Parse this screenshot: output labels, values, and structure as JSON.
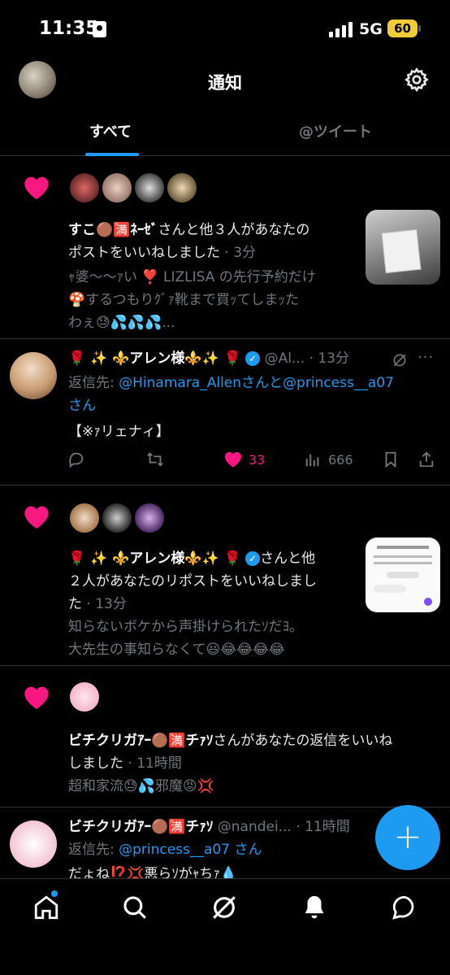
{
  "status": {
    "time": "11:35",
    "network": "5G",
    "battery": "60"
  },
  "header": {
    "title": "通知",
    "avatar_icon": "profile-avatar",
    "settings_icon": "gear-icon"
  },
  "tabs": [
    {
      "label": "すべて",
      "active": true
    },
    {
      "label": "@ツイート",
      "active": false
    }
  ],
  "notifications": [
    {
      "type": "like",
      "line1_name": "すこ🟤🈵ﾈｰｾﾞ",
      "line1_rest": "さんと他３人があなたの",
      "line2": "ポストをいいねしました",
      "time": "· 3分",
      "preview1": "ｬ婆〜〜ｧい ❣️ LIZLISA の先行予約だけ",
      "preview2": "🍄するつもりｸﾞｧ靴まで買ｯてしまｯた",
      "preview3": "わぇ😓💦💦💦..."
    },
    {
      "type": "reply",
      "name": "🌹 ✨ ⚜️アレン様⚜️✨ 🌹",
      "handle": "@Al...",
      "time": "· 13分",
      "reply_prefix": "返信先: ",
      "reply_user1": "@Hinamara_Allen",
      "reply_mid": "さんと",
      "reply_user2": "@princess__a07",
      "reply_suffix": "さん",
      "body": "【※ｧリェナィ】",
      "likes": "33",
      "views": "666"
    },
    {
      "type": "like",
      "line1_name": "🌹 ✨ ⚜️アレン様⚜️✨ 🌹",
      "line1_rest": "さんと他",
      "line2": "２人があなたのリポストをいいねしまし",
      "line3": "た",
      "time": "· 13分",
      "preview1": "知らないボケから声掛けられたｿだﾖ｡",
      "preview2": "大先生の事知らなくて😃😂😂😂😂"
    },
    {
      "type": "like",
      "line1_name": "ビチクリガｱｰ🟤🈵チｧｿ",
      "line1_rest": "さんがあなたの返信をいいね",
      "line2": "しました",
      "time": "· 11時間",
      "preview1": "超和家流😓💦邪魔😡💢"
    },
    {
      "type": "reply",
      "name": "ビチクリガｱｰ🟤🈵チｧｿ",
      "handle": "@nandei...",
      "time": "· 11時間",
      "reply_prefix": "返信先: ",
      "reply_user1": "@princess__a07",
      "reply_suffix": "さん",
      "body": "だょね⁉️💢悪らｿがｬちｧ💧"
    }
  ],
  "fab_label": "+",
  "nav": [
    "home-icon",
    "search-icon",
    "grok-icon",
    "bell-icon",
    "messages-icon"
  ],
  "colors": {
    "accent": "#1d9bf0",
    "like": "#f91880",
    "battery": "#f2cc38"
  }
}
